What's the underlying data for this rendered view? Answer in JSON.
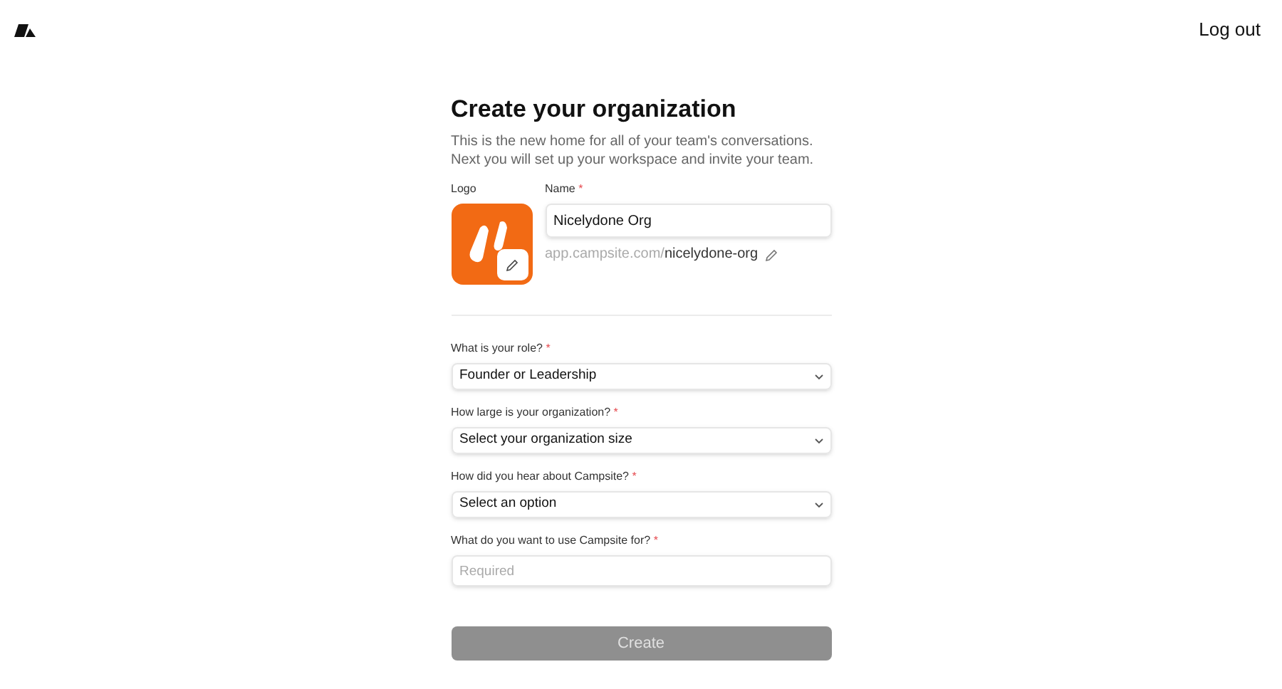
{
  "header": {
    "logout": "Log out"
  },
  "form": {
    "title": "Create your organization",
    "description": "This is the new home for all of your team's conversations. Next you will set up your workspace and invite your team.",
    "logo_label": "Logo",
    "name_field": {
      "label": "Name",
      "required_mark": "*",
      "value": "Nicelydone Org"
    },
    "url": {
      "prefix": "app.campsite.com/",
      "slug": "nicelydone-org"
    },
    "questions": [
      {
        "kind": "select",
        "label": "What is your role?",
        "required_mark": "*",
        "value": "Founder or Leadership"
      },
      {
        "kind": "select",
        "label": "How large is your organization?",
        "required_mark": "*",
        "value": "Select your organization size"
      },
      {
        "kind": "select",
        "label": "How did you hear about Campsite?",
        "required_mark": "*",
        "value": "Select an option"
      },
      {
        "kind": "text",
        "label": "What do you want to use Campsite for?",
        "required_mark": "*",
        "placeholder": "Required"
      }
    ],
    "submit": {
      "label": "Create",
      "disabled": true
    }
  }
}
